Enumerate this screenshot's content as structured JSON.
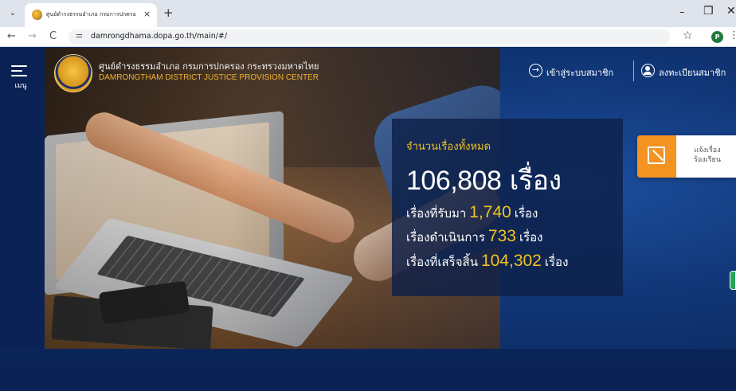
{
  "browser": {
    "tab_list_icon": "chevron-down-icon",
    "tab_title": "ศูนย์ดำรงธรรมอำเภอ กรมการปกครอ",
    "tab_close": "×",
    "new_tab": "+",
    "window_controls": {
      "minimize": "–",
      "maximize": "❐",
      "close": "✕"
    },
    "nav": {
      "back": "←",
      "forward": "→",
      "reload": "C"
    },
    "site_info_icon": "⚌",
    "url": "damrongdhama.dopa.go.th/main/#/",
    "star": "☆",
    "profile_initial": "P",
    "more": "⋮"
  },
  "sidebar": {
    "menu_label": "เมนู"
  },
  "header": {
    "org_name_th": "ศูนย์ดำรงธรรมอำเภอ กรมการปกครอง กระทรวงมหาดไทย",
    "org_name_en": "DAMRONGTHAM DISTRICT JUSTICE PROVISION CENTER",
    "login_label": "เข้าสู่ระบบสมาชิก",
    "login_icon": "login-icon",
    "register_label": "ลงทะเบียนสมาชิก",
    "register_icon": "user-icon"
  },
  "stats": {
    "heading": "จำนวนเรื่องทั้งหมด",
    "total_value": "106,808",
    "total_unit": "เรื่อง",
    "rows": [
      {
        "label": "เรื่องที่รับมา",
        "value": "1,740",
        "unit": "เรื่อง"
      },
      {
        "label": "เรื่องดำเนินการ",
        "value": "733",
        "unit": "เรื่อง"
      },
      {
        "label": "เรื่องที่เสร็จสิ้น",
        "value": "104,302",
        "unit": "เรื่อง"
      }
    ]
  },
  "complaint": {
    "line1": "แจ้งเรื่อง",
    "line2": "ร้องเรียน",
    "icon": "edit-icon"
  },
  "colors": {
    "accent_gold": "#f4c21f",
    "orange": "#f39322",
    "navy": "#0a2254"
  }
}
